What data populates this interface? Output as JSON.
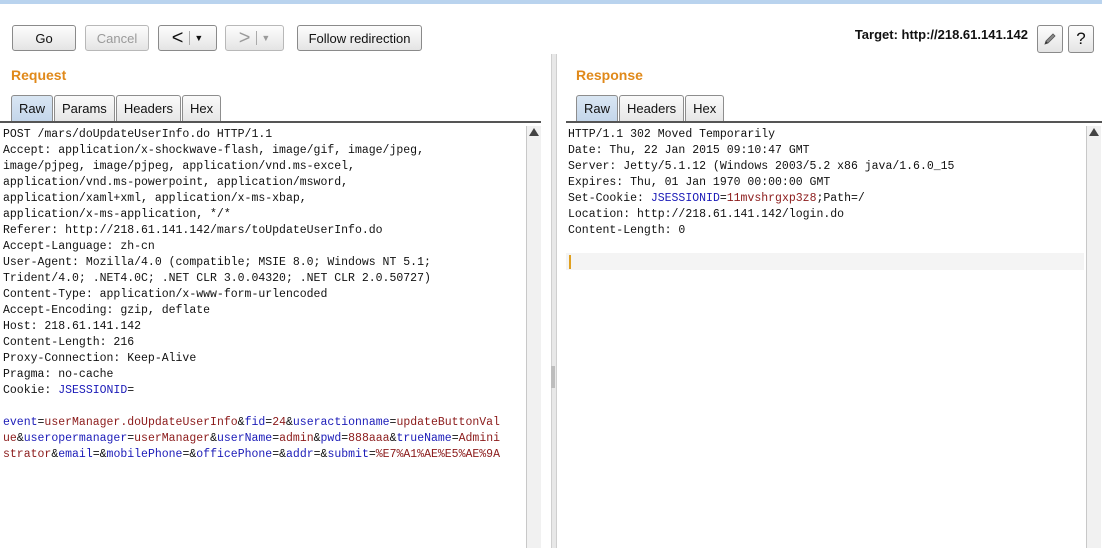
{
  "toolbar": {
    "go": "Go",
    "cancel": "Cancel",
    "back_arrow": "<",
    "forward_arrow": ">",
    "dropdown_caret": "▼",
    "follow": "Follow redirection",
    "target": "Target: http://218.61.141.142",
    "edit_icon": "pencil-icon",
    "help": "?"
  },
  "request": {
    "title": "Request",
    "tabs": [
      "Raw",
      "Params",
      "Headers",
      "Hex"
    ],
    "active_tab": "Raw",
    "lines": [
      "POST /mars/doUpdateUserInfo.do HTTP/1.1",
      "Accept: application/x-shockwave-flash, image/gif, image/jpeg,",
      "image/pjpeg, image/pjpeg, application/vnd.ms-excel,",
      "application/vnd.ms-powerpoint, application/msword,",
      "application/xaml+xml, application/x-ms-xbap,",
      "application/x-ms-application, */*",
      "Referer: http://218.61.141.142/mars/toUpdateUserInfo.do",
      "Accept-Language: zh-cn",
      "User-Agent: Mozilla/4.0 (compatible; MSIE 8.0; Windows NT 5.1;",
      "Trident/4.0; .NET4.0C; .NET CLR 3.0.04320; .NET CLR 2.0.50727)",
      "Content-Type: application/x-www-form-urlencoded",
      "Accept-Encoding: gzip, deflate",
      "Host: 218.61.141.142",
      "Content-Length: 216",
      "Proxy-Connection: Keep-Alive",
      "Pragma: no-cache"
    ],
    "cookie_label": "Cookie: ",
    "cookie_name": "JSESSIONID",
    "cookie_eq": "=",
    "body_lines": [
      [
        [
          "k",
          "event"
        ],
        [
          "p",
          "="
        ],
        [
          "v",
          "userManager.doUpdateUserInfo"
        ],
        [
          "p",
          "&"
        ],
        [
          "k",
          "fid"
        ],
        [
          "p",
          "="
        ],
        [
          "v",
          "24"
        ],
        [
          "p",
          "&"
        ],
        [
          "k",
          "useractionname"
        ],
        [
          "p",
          "="
        ],
        [
          "v",
          "updateButtonVal"
        ]
      ],
      [
        [
          "v",
          "ue"
        ],
        [
          "p",
          "&"
        ],
        [
          "k",
          "useropermanager"
        ],
        [
          "p",
          "="
        ],
        [
          "v",
          "userManager"
        ],
        [
          "p",
          "&"
        ],
        [
          "k",
          "userName"
        ],
        [
          "p",
          "="
        ],
        [
          "v",
          "admin"
        ],
        [
          "p",
          "&"
        ],
        [
          "k",
          "pwd"
        ],
        [
          "p",
          "="
        ],
        [
          "v",
          "888aaa"
        ],
        [
          "p",
          "&"
        ],
        [
          "k",
          "trueName"
        ],
        [
          "p",
          "="
        ],
        [
          "v",
          "Admini"
        ]
      ],
      [
        [
          "v",
          "strator"
        ],
        [
          "p",
          "&"
        ],
        [
          "k",
          "email"
        ],
        [
          "p",
          "=&"
        ],
        [
          "k",
          "mobilePhone"
        ],
        [
          "p",
          "=&"
        ],
        [
          "k",
          "officePhone"
        ],
        [
          "p",
          "=&"
        ],
        [
          "k",
          "addr"
        ],
        [
          "p",
          "=&"
        ],
        [
          "k",
          "submit"
        ],
        [
          "p",
          "="
        ],
        [
          "v",
          "%E7%A1%AE%E5%AE%9A"
        ]
      ]
    ]
  },
  "response": {
    "title": "Response",
    "tabs": [
      "Raw",
      "Headers",
      "Hex"
    ],
    "active_tab": "Raw",
    "lines": [
      "HTTP/1.1 302 Moved Temporarily",
      "Date: Thu, 22 Jan 2015 09:10:47 GMT",
      "Server: Jetty/5.1.12 (Windows 2003/5.2 x86 java/1.6.0_15",
      "Expires: Thu, 01 Jan 1970 00:00:00 GMT"
    ],
    "setcookie_label": "Set-Cookie: ",
    "setcookie_name": "JSESSIONID",
    "setcookie_eq": "=",
    "setcookie_value": "11mvshrgxp3z8",
    "setcookie_tail": ";Path=/",
    "lines2": [
      "Location: http://218.61.141.142/login.do",
      "Content-Length: 0"
    ]
  }
}
